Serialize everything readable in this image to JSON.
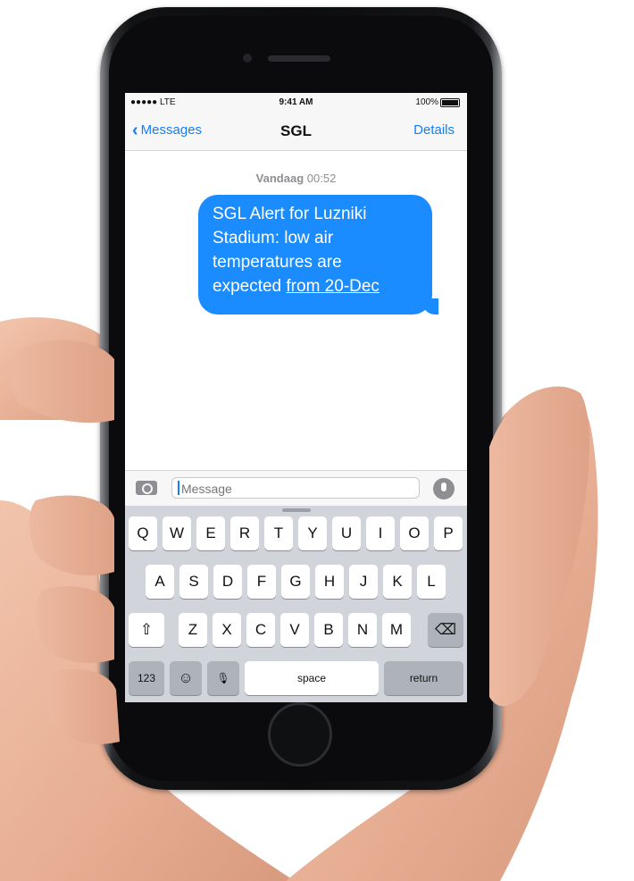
{
  "status_bar": {
    "signal": "●●●●● LTE",
    "time": "9:41 AM",
    "battery": "100%"
  },
  "nav": {
    "back_label": "Messages",
    "title": "SGL",
    "details_label": "Details"
  },
  "conversation": {
    "timestamp_day": "Vandaag",
    "timestamp_time": "00:52",
    "message_lines": [
      "SGL Alert for Luzniki",
      "Stadium: low air",
      "temperatures are"
    ],
    "message_last_prefix": "expected ",
    "message_link": "from 20-Dec"
  },
  "input": {
    "placeholder": "Message"
  },
  "keyboard": {
    "row1": [
      "Q",
      "W",
      "E",
      "R",
      "T",
      "Y",
      "U",
      "I",
      "O",
      "P"
    ],
    "row2": [
      "A",
      "S",
      "D",
      "F",
      "G",
      "H",
      "J",
      "K",
      "L"
    ],
    "row3": [
      "Z",
      "X",
      "C",
      "V",
      "B",
      "N",
      "M"
    ],
    "numbers_label": "123",
    "space_label": "space",
    "return_label": "return"
  },
  "colors": {
    "bubble": "#1a8cff",
    "link_blue": "#147efb",
    "skin": "#e9b79e"
  }
}
